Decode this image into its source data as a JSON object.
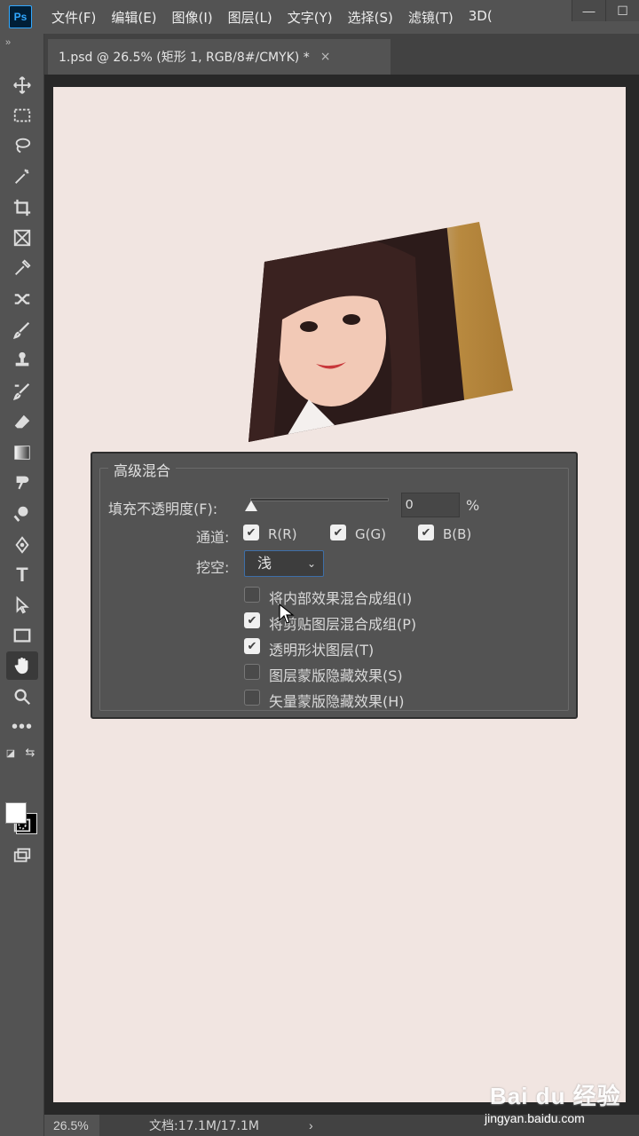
{
  "app": {
    "logo": "Ps"
  },
  "menu": [
    "文件(F)",
    "编辑(E)",
    "图像(I)",
    "图层(L)",
    "文字(Y)",
    "选择(S)",
    "滤镜(T)",
    "3D("
  ],
  "window_buttons": {
    "minimize": "—",
    "maximize": "☐"
  },
  "toolbar": {
    "grip": "»",
    "tools": [
      "move-icon",
      "marquee-icon",
      "lasso-icon",
      "magic-wand-icon",
      "crop-icon",
      "frame-icon",
      "eyedropper-icon",
      "healing-icon",
      "brush-icon",
      "stamp-icon",
      "history-brush-icon",
      "eraser-icon",
      "gradient-icon",
      "smudge-icon",
      "dodge-icon",
      "pen-icon",
      "type-icon",
      "path-select-icon",
      "rectangle-icon",
      "hand-icon",
      "zoom-icon",
      "more-icon"
    ],
    "active_tool": "hand-icon",
    "foreground_color": "#ffffff",
    "background_color": "#000000"
  },
  "tab": {
    "title": "1.psd @ 26.5% (矩形 1, RGB/8#/CMYK) *",
    "close": "×"
  },
  "canvas": {
    "background": "#f1e5e1"
  },
  "dialog": {
    "title": "高级混合",
    "fill_opacity_label": "填充不透明度(F):",
    "fill_opacity_value": "0",
    "fill_opacity_unit": "%",
    "fill_opacity_level": 0,
    "channels_label": "通道:",
    "channels": [
      {
        "label": "R(R)",
        "checked": true
      },
      {
        "label": "G(G)",
        "checked": true
      },
      {
        "label": "B(B)",
        "checked": true
      }
    ],
    "knockout_label": "挖空:",
    "knockout_value": "浅",
    "options": [
      {
        "label": "将内部效果混合成组(I)",
        "checked": false
      },
      {
        "label": "将剪贴图层混合成组(P)",
        "checked": true
      },
      {
        "label": "透明形状图层(T)",
        "checked": true
      },
      {
        "label": "图层蒙版隐藏效果(S)",
        "checked": false
      },
      {
        "label": "矢量蒙版隐藏效果(H)",
        "checked": false
      }
    ]
  },
  "status": {
    "zoom": "26.5%",
    "doc": "文档:17.1M/17.1M",
    "arrow": "›"
  },
  "watermark": {
    "brand": "Bai du 经验",
    "site": "jingyan.baidu.com"
  }
}
